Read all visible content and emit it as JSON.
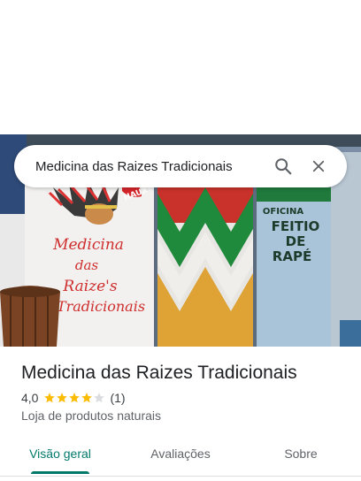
{
  "search": {
    "query": "Medicina das Raizes Tradicionais"
  },
  "photo": {
    "sign_left": [
      "Medicina",
      "das",
      "Raize's",
      "Tradicionais"
    ],
    "sign_small": "HAUX!",
    "sign_right": [
      "OFICINA",
      "FEITIO",
      "DE",
      "RAPÉ"
    ]
  },
  "place": {
    "name": "Medicina das Raizes Tradicionais",
    "rating": "4,0",
    "stars_filled": 4,
    "stars_total": 5,
    "review_count": "(1)",
    "category": "Loja de produtos naturais"
  },
  "tabs": [
    {
      "label": "Visão geral",
      "active": true
    },
    {
      "label": "Avaliações",
      "active": false
    },
    {
      "label": "Sobre",
      "active": false
    }
  ],
  "colors": {
    "accent": "#00796b",
    "star": "#fbbc04",
    "star_empty": "#dadce0"
  }
}
